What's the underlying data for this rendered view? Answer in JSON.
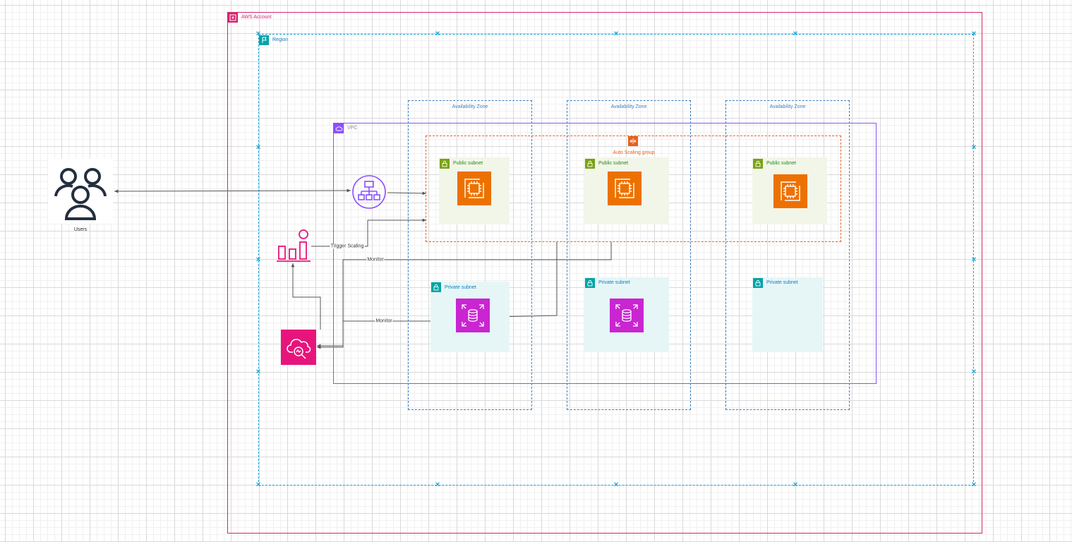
{
  "labels": {
    "aws_account": "AWS Account",
    "region": "Region",
    "vpc": "VPC",
    "az1": "Availability Zone",
    "az2": "Availability Zone",
    "az3": "Availability Zone",
    "asg": "Auto Scaling group",
    "public_subnet_1": "Public subnet",
    "public_subnet_2": "Public subnet",
    "public_subnet_3": "Public subnet",
    "private_subnet_1": "Private subnet",
    "private_subnet_2": "Private subnet",
    "private_subnet_3": "Private subnet",
    "users": "Users"
  },
  "edges": {
    "trigger_scaling": "Trigger Scaling",
    "monitor_ec2": "Monitor",
    "monitor_rds": "Monitor"
  },
  "colors": {
    "aws_account": "#d6246e",
    "region": "#19a2d6",
    "vpc": "#8c4fff",
    "az": "#3f7fbf",
    "asg": "#e7601d",
    "public_subnet_fill": "#f2f6e8",
    "public_subnet_accent": "#7aa116",
    "private_subnet_fill": "#e6f6f7",
    "private_subnet_accent": "#00a4a6",
    "ec2": "#ed7100",
    "rds": "#c925d1",
    "cloudwatch": "#e7157b",
    "load_balancer": "#8c4fff",
    "users_icon": "#232f3e",
    "connector": "#555555"
  },
  "icons": {
    "aws_account": "aws-account-icon",
    "region": "region-flag-icon",
    "vpc": "vpc-cloud-icon",
    "asg": "auto-scaling-icon",
    "subnet": "padlock-icon",
    "ec2": "ec2-instance-icon",
    "rds": "rds-database-icon",
    "load_balancer": "elastic-load-balancer-icon",
    "auto_scaling_metrics": "auto-scaling-metrics-icon",
    "cloudwatch": "cloudwatch-icon",
    "users": "users-icon"
  }
}
